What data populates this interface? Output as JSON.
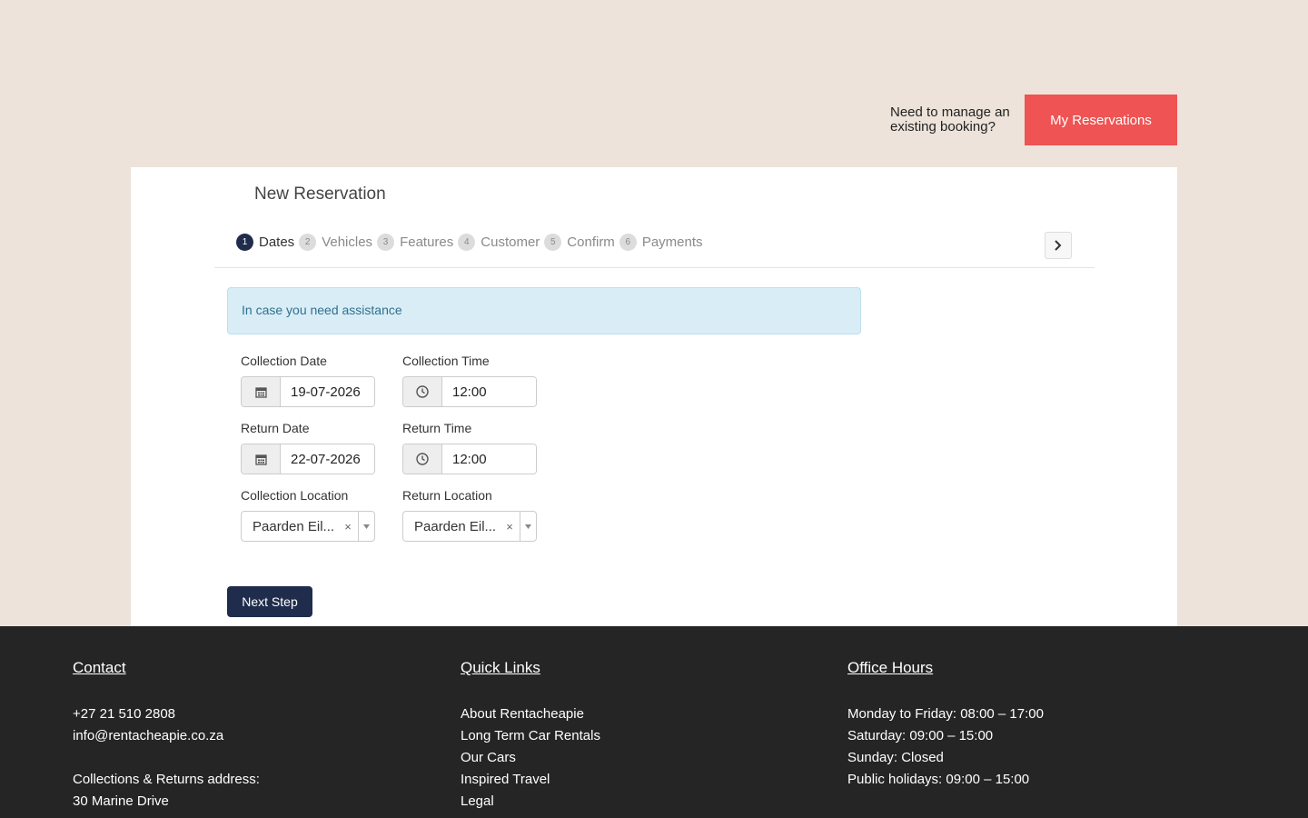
{
  "header": {
    "manage_text": "Need to manage an existing booking?",
    "my_reservations_label": "My Reservations"
  },
  "reservation": {
    "title": "New Reservation",
    "steps": [
      {
        "num": "1",
        "label": "Dates",
        "active": true
      },
      {
        "num": "2",
        "label": "Vehicles"
      },
      {
        "num": "3",
        "label": "Features"
      },
      {
        "num": "4",
        "label": "Customer"
      },
      {
        "num": "5",
        "label": "Confirm"
      },
      {
        "num": "6",
        "label": "Payments"
      }
    ],
    "alert": "In case you need assistance",
    "collection_date": {
      "label": "Collection Date",
      "value": "19-07-2026"
    },
    "collection_time": {
      "label": "Collection Time",
      "value": "12:00"
    },
    "return_date": {
      "label": "Return Date",
      "value": "22-07-2026"
    },
    "return_time": {
      "label": "Return Time",
      "value": "12:00"
    },
    "collection_location": {
      "label": "Collection Location",
      "value": "Paarden Eil..."
    },
    "return_location": {
      "label": "Return Location",
      "value": "Paarden Eil..."
    },
    "next_step_label": "Next Step"
  },
  "footer": {
    "contact": {
      "title": "Contact",
      "phone": "+27 21 510 2808",
      "email": "info@rentacheapie.co.za",
      "address_label": "Collections & Returns address:",
      "address_line1": "30 Marine Drive"
    },
    "quick_links": {
      "title": "Quick Links",
      "links": [
        "About Rentacheapie",
        "Long Term Car Rentals",
        "Our Cars",
        "Inspired Travel",
        "Legal"
      ]
    },
    "office_hours": {
      "title": "Office Hours",
      "lines": [
        "Monday to Friday: 08:00 – 17:00",
        "Saturday: 09:00 – 15:00",
        "Sunday: Closed",
        "Public holidays: 09:00 – 15:00"
      ]
    }
  },
  "colors": {
    "page_bg": "#ede3da",
    "accent_red": "#ef5353",
    "navy": "#1f2c4c",
    "footer_bg": "#252525",
    "alert_bg": "#d9edf6"
  }
}
